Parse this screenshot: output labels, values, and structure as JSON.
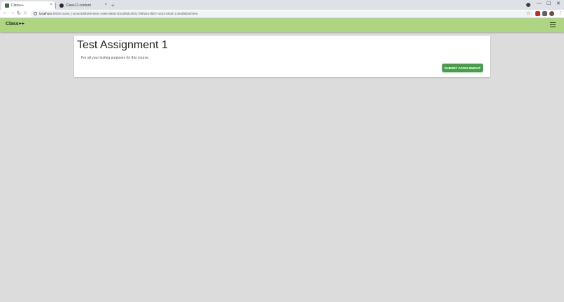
{
  "browser": {
    "tabs": [
      {
        "title": "Class++",
        "active": true
      },
      {
        "title": "Class-D-content",
        "active": false
      }
    ],
    "new_tab": "+",
    "close_glyph": "×",
    "url_host": "localhost",
    "url_path": ":3000/course_home/3d0fa08-5e5c-4655-9866-f1b4df8dcef5/1799f264-dd07-4e23-b9d3-1cdeaf8b09/view",
    "window_controls": [
      "—",
      "☐",
      "✕"
    ]
  },
  "app": {
    "brand": "Class++",
    "accent": "#aed581"
  },
  "assignment": {
    "title": "Test Assignment 1",
    "description": "For all your testing purposes for this course.",
    "submit_label": "SUBMIT ASSIGNMENT",
    "submit_color": "#43a047"
  },
  "icons": {
    "back": "←",
    "forward": "→",
    "reload": "↻",
    "home": "⌂",
    "star": "☆"
  }
}
